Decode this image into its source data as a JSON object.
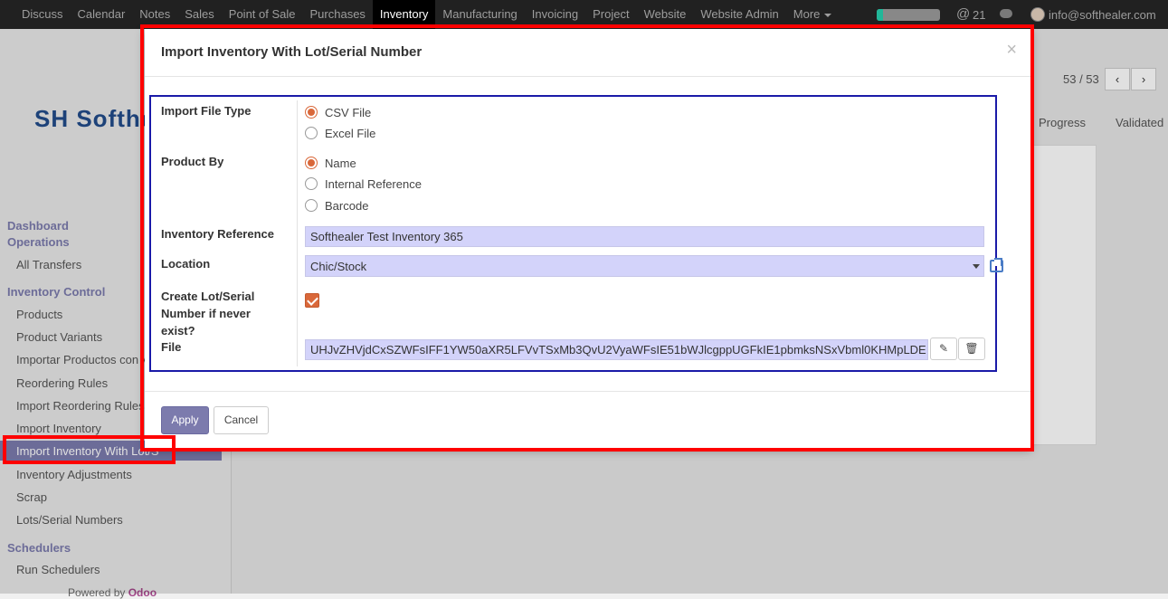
{
  "navbar": {
    "menu": [
      {
        "label": "Discuss"
      },
      {
        "label": "Calendar"
      },
      {
        "label": "Notes"
      },
      {
        "label": "Sales"
      },
      {
        "label": "Point of Sale"
      },
      {
        "label": "Purchases"
      },
      {
        "label": "Inventory",
        "active": true
      },
      {
        "label": "Manufacturing"
      },
      {
        "label": "Invoicing"
      },
      {
        "label": "Project"
      },
      {
        "label": "Website"
      },
      {
        "label": "Website Admin"
      },
      {
        "label": "More"
      }
    ],
    "activity_progress": 0.1,
    "mention_icon": "@",
    "mention_count": "21",
    "user_email": "info@softhealer.com"
  },
  "sidebar": {
    "logo_text": "SH Softhe",
    "sections": [
      {
        "title": "Dashboard Operations"
      },
      {
        "title": "Inventory Control"
      },
      {
        "title": "Schedulers"
      }
    ],
    "items": [
      {
        "label": "All Transfers"
      },
      {
        "label": "Products"
      },
      {
        "label": "Product Variants"
      },
      {
        "label": "Importar Productos con V"
      },
      {
        "label": "Reordering Rules"
      },
      {
        "label": "Import Reordering Rules"
      },
      {
        "label": "Import Inventory"
      },
      {
        "label": "Import Inventory With Lot/S"
      },
      {
        "label": "Inventory Adjustments"
      },
      {
        "label": "Scrap"
      },
      {
        "label": "Lots/Serial Numbers"
      },
      {
        "label": "Run Schedulers"
      }
    ],
    "powered_by": "Powered by",
    "powered_brand": "Odoo"
  },
  "background": {
    "pager": "53 / 53",
    "pager_prev": "‹",
    "pager_next": "›",
    "stages": [
      "Progress",
      "Validated"
    ]
  },
  "modal": {
    "title": "Import Inventory With Lot/Serial Number",
    "close": "×",
    "fields": {
      "file_type_label": "Import File Type",
      "file_type_options": [
        {
          "label": "CSV File",
          "checked": true
        },
        {
          "label": "Excel File",
          "checked": false
        }
      ],
      "product_by_label": "Product By",
      "product_by_options": [
        {
          "label": "Name",
          "checked": true
        },
        {
          "label": "Internal Reference",
          "checked": false
        },
        {
          "label": "Barcode",
          "checked": false
        }
      ],
      "inventory_ref_label": "Inventory Reference",
      "inventory_ref_value": "Softhealer Test Inventory 365",
      "location_label": "Location",
      "location_value": "Chic/Stock",
      "create_lot_label": "Create Lot/Serial Number if never exist?",
      "create_lot_checked": true,
      "file_label": "File",
      "file_value": "UHJvZHVjdCxSZWFsIFF1YW50aXR5LFVvTSxMb3QvU2VyaWFsIE51bWJlcgppUGFkIE1pbmksNSxVbml0KHMpLDE"
    },
    "buttons": {
      "apply": "Apply",
      "cancel": "Cancel",
      "edit_icon": "✎",
      "delete_icon": "🗑"
    }
  },
  "colors": {
    "navbar_bg": "#212121",
    "accent": "#7c7bad",
    "radio_checked": "#d9683a",
    "input_required_bg": "#d3d3fa",
    "highlight": "#ff0000",
    "form_border": "#1a1aa8"
  }
}
